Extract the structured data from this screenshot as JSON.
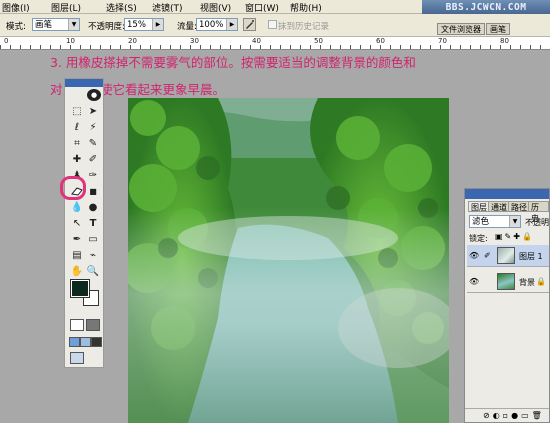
{
  "menu": {
    "items": [
      "图像(I)",
      "图层(L)",
      "选择(S)",
      "滤镜(T)",
      "视图(V)",
      "窗口(W)",
      "帮助(H)"
    ],
    "watermark": "BBS.JCWCN.COM"
  },
  "options_bar": {
    "mode_label": "模式:",
    "mode_value": "画笔",
    "opacity_label": "不透明度:",
    "opacity_value": "15%",
    "flow_label": "流量:",
    "flow_value": "100%",
    "erase_history_label": "抹到历史记录",
    "file_browser_tab": "文件浏览器",
    "brush_tab": "画笔"
  },
  "ruler": {
    "labels": [
      "0",
      "10",
      "20",
      "30",
      "40",
      "50",
      "60",
      "70",
      "80"
    ]
  },
  "instruction": {
    "line1": "3. 用橡皮搽掉不需要雾气的部位。按需要适当的调整背景的颜色和",
    "line2": "对比度，使它看起来更象早晨。"
  },
  "toolbox": {
    "tools": [
      "move-icon",
      "marquee-icon",
      "lasso-icon",
      "magic-wand-icon",
      "crop-icon",
      "slice-icon",
      "healing-brush-icon",
      "brush-icon",
      "clone-stamp-icon",
      "history-brush-icon",
      "eraser-icon",
      "gradient-icon",
      "blur-icon",
      "dodge-icon",
      "path-select-icon",
      "type-icon",
      "pen-icon",
      "shape-icon",
      "notes-icon",
      "eyedropper-icon",
      "hand-icon",
      "zoom-icon"
    ],
    "foreground_color": "#0b2a1d",
    "background_color": "#ffffff",
    "highlight_color": "#e0337a"
  },
  "layers_panel": {
    "tabs": [
      "图层",
      "通道",
      "路径",
      "历史"
    ],
    "blend_mode": "滤色",
    "opacity_label": "不透明",
    "lock_label": "锁定:",
    "layers": [
      {
        "name": "图层 1"
      },
      {
        "name": "背景"
      }
    ]
  },
  "colors": {
    "instruction_text": "#d2236f",
    "panel_bg": "#ecebe6",
    "workspace": "#a8a8a8"
  }
}
